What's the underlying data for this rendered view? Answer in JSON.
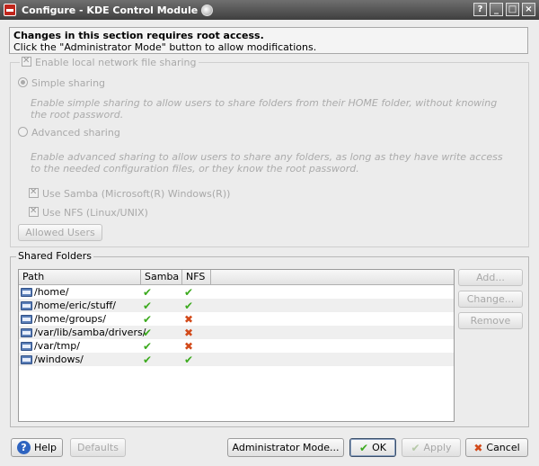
{
  "window": {
    "title": "Configure - KDE Control Module",
    "buttons": [
      "?",
      "_",
      "□",
      "×"
    ]
  },
  "info": {
    "title": "Changes in this section requires root access.",
    "subtitle": "Click the \"Administrator Mode\" button to allow modifications."
  },
  "sharing": {
    "enable_label": "Enable local network file sharing",
    "simple_label": "Simple sharing",
    "simple_desc": "Enable simple sharing to allow users to share folders from their HOME folder, without knowing the root password.",
    "advanced_label": "Advanced sharing",
    "advanced_desc": "Enable advanced sharing to allow users to share any folders, as long as they have write access to the needed configuration files, or they know the root password.",
    "samba_label": "Use Samba (Microsoft(R) Windows(R))",
    "nfs_label": "Use NFS (Linux/UNIX)",
    "allowed_users_label": "Allowed Users"
  },
  "folders": {
    "group_title": "Shared Folders",
    "columns": [
      "Path",
      "Samba",
      "NFS"
    ],
    "rows": [
      {
        "path": "/home/",
        "samba": "✔",
        "nfs": "✔"
      },
      {
        "path": "/home/eric/stuff/",
        "samba": "✔",
        "nfs": "✔"
      },
      {
        "path": "/home/groups/",
        "samba": "✔",
        "nfs": "✖"
      },
      {
        "path": "/var/lib/samba/drivers/",
        "samba": "✔",
        "nfs": "✖"
      },
      {
        "path": "/var/tmp/",
        "samba": "✔",
        "nfs": "✖"
      },
      {
        "path": "/windows/",
        "samba": "✔",
        "nfs": "✔"
      }
    ],
    "add_label": "Add...",
    "change_label": "Change...",
    "remove_label": "Remove"
  },
  "footer": {
    "help_label": "Help",
    "defaults_label": "Defaults",
    "admin_label": "Administrator Mode...",
    "ok_label": "OK",
    "apply_label": "Apply",
    "cancel_label": "Cancel"
  },
  "icons": {
    "app": "kde-control-module-icon",
    "busy": "busy-indicator-icon",
    "folder": "folder-icon",
    "check": "checkmark-icon",
    "cross": "cross-icon",
    "help": "help-icon"
  },
  "colors": {
    "check": "#3caa1e",
    "cross": "#d24a1a",
    "titlebar": "#4a4a4a"
  }
}
